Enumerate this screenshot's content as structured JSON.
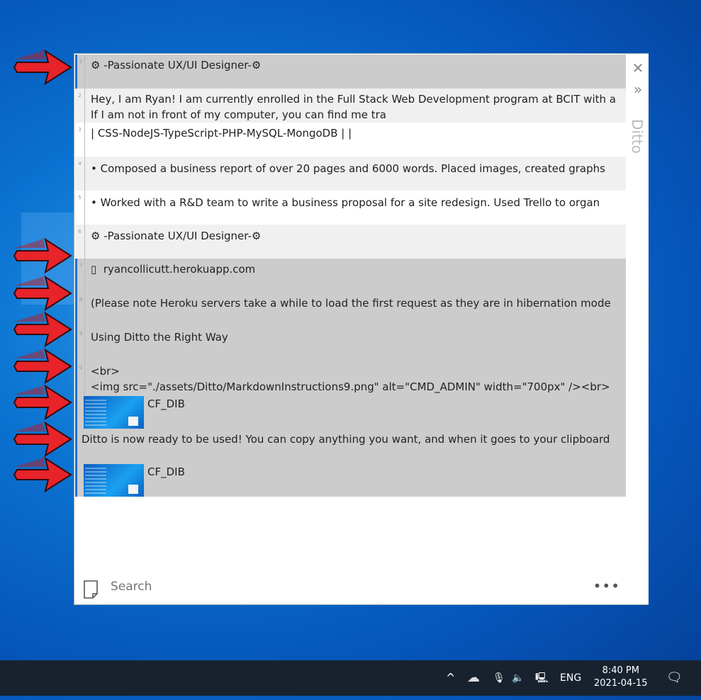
{
  "window": {
    "title": "Ditto",
    "close_icon": "close-icon",
    "expand_icon": "double-chevron-right-icon"
  },
  "clips": [
    {
      "num": "1",
      "text": "-Passionate UX/UI Designer-",
      "selected": true
    },
    {
      "num": "2",
      "text": "Hey, I am Ryan! I am currently enrolled in the Full Stack Web Development program at BCIT with a",
      "text2": "If I am not in front of my computer, you can find me tra"
    },
    {
      "num": "3",
      "text": "| CSS-NodeJS-TypeScript-PHP-MySQL-MongoDB | |"
    },
    {
      "num": "4",
      "text": "•  Composed a business report of over 20 pages and 6000 words. Placed images, created graphs"
    },
    {
      "num": "5",
      "text": "•  Worked with a R&D team to write a business proposal for a site redesign. Used Trello to organ"
    },
    {
      "num": "6",
      "text": "-Passionate UX/UI Designer-"
    },
    {
      "num": "7",
      "text": "ryancollicutt.herokuapp.com",
      "selected": true
    },
    {
      "num": "8",
      "text": "(Please note Heroku servers take a while to load the first request as they are in hibernation mode",
      "selected": true
    },
    {
      "num": "9",
      "text": "Using Ditto the Right Way",
      "selected": true
    },
    {
      "num": "0",
      "text": "<br>",
      "text2": "<img src=\"./assets/Ditto/MarkdownInstructions9.png\" alt=\"CMD_ADMIN\" width=\"700px\" /><br>",
      "selected": true
    },
    {
      "text": "CF_DIB",
      "selected": true
    },
    {
      "text": "Ditto is now ready to be used! You can copy anything you want, and when it goes to your clipboard",
      "selected": true
    },
    {
      "text": "CF_DIB",
      "selected": true
    }
  ],
  "search": {
    "placeholder": "Search",
    "menu": "•••"
  },
  "taskbar": {
    "lang": "ENG",
    "time": "8:40 PM",
    "date": "2021-04-15"
  }
}
